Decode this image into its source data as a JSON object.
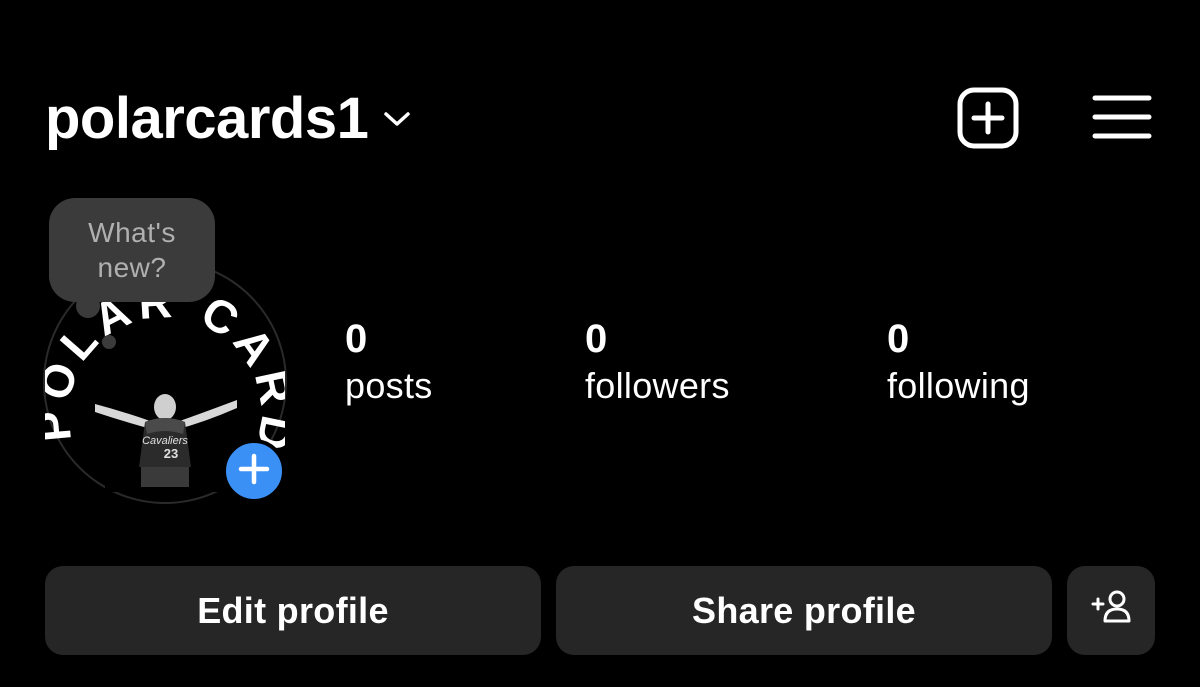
{
  "profile": {
    "username": "polarcards1",
    "avatar_text": "POLAR CARDS",
    "jersey_number": "23"
  },
  "note": {
    "line1": "What's",
    "line2": "new?"
  },
  "stats": {
    "posts": {
      "count": "0",
      "label": "posts"
    },
    "followers": {
      "count": "0",
      "label": "followers"
    },
    "following": {
      "count": "0",
      "label": "following"
    }
  },
  "actions": {
    "edit_label": "Edit profile",
    "share_label": "Share profile"
  },
  "icons": {
    "chevron": "chevron-down-icon",
    "new_post": "plus-square-icon",
    "menu": "hamburger-menu-icon",
    "add_story": "plus-icon",
    "suggest": "add-person-icon"
  },
  "colors": {
    "background": "#000000",
    "button": "#262626",
    "accent_blue": "#3b90f5",
    "note_bubble": "#3b3b3b"
  }
}
